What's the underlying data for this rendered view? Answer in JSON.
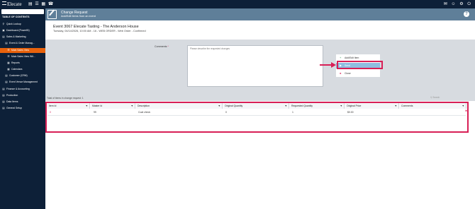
{
  "app": {
    "logo": "Elecate"
  },
  "topbar": {
    "left_icons": "▤ ☰ ▦ ☎",
    "right_icons": "✉ ☺ ⚙ ⏻"
  },
  "sidebar": {
    "toc_label": "TABLE OF CONTENTS",
    "items": [
      {
        "label": "Quick Lookup",
        "icon": "search-icon",
        "glyph": "⚲"
      },
      {
        "label": "Dashboard (PowerBI)",
        "icon": "dashboard-icon",
        "glyph": "▣"
      },
      {
        "label": "Sales & Marketing",
        "icon": "folder-icon",
        "glyph": "▤"
      },
      {
        "label": "Event & Order Manag...",
        "icon": "folder-icon",
        "glyph": "▤"
      },
      {
        "label": "Main Sales View",
        "icon": "list-icon",
        "glyph": "☰"
      },
      {
        "label": "Main Sales View Wit...",
        "icon": "list-icon",
        "glyph": "☰"
      },
      {
        "label": "Reports",
        "icon": "reports-icon",
        "glyph": "▦"
      },
      {
        "label": "Calendars",
        "icon": "calendar-icon",
        "glyph": "▦"
      },
      {
        "label": "Customer (CRM)",
        "icon": "folder-icon",
        "glyph": "▤"
      },
      {
        "label": "Event Venue Management",
        "icon": "folder-icon",
        "glyph": "▤"
      },
      {
        "label": "Finance & Accounting",
        "icon": "folder-icon",
        "glyph": "▤"
      },
      {
        "label": "Production",
        "icon": "folder-icon",
        "glyph": "▤"
      },
      {
        "label": "Data Items",
        "icon": "folder-icon",
        "glyph": "▤"
      },
      {
        "label": "General Setup",
        "icon": "folder-icon",
        "glyph": "▤"
      }
    ]
  },
  "header": {
    "title": "Change Request",
    "subtitle": "Add/Edit Items from an event",
    "help": "?"
  },
  "event": {
    "title": "Event 3067 Elecate Tasting - The Anderson House",
    "details": "Tuesday, 04/14/2026, 10:00 AM - 16 - WEB ORDER - Web Order - Confirmed"
  },
  "comments": {
    "label": "Comments",
    "required_mark": "*",
    "placeholder": "Please describe the requested changes"
  },
  "actions": {
    "add_label": "Add/Edit Item",
    "add_glyph": "+",
    "save_label": "Send",
    "save_glyph": "▶",
    "close_label": "Close",
    "close_glyph": "✖"
  },
  "grid": {
    "total_label": "Total of items in change request: 1",
    "search_placeholder": "⚲ Search",
    "filter_glyph": "▼",
    "delete_glyph": "✖",
    "columns": [
      "Item Id",
      "Master Id",
      "Description",
      "Original Quantity",
      "Requested Quantity",
      "Original Price",
      "Comments"
    ],
    "rows": [
      {
        "item_id": "0",
        "master_id": "99",
        "description": "Coat check",
        "original_quantity": "0",
        "requested_quantity": "1",
        "original_price": "$0.00",
        "comments": ""
      }
    ]
  },
  "colors": {
    "nav_bg": "#0d2038",
    "active": "#e8620c",
    "header": "#5f7f99",
    "highlight": "#d81f56",
    "send": "#8fbde0"
  }
}
